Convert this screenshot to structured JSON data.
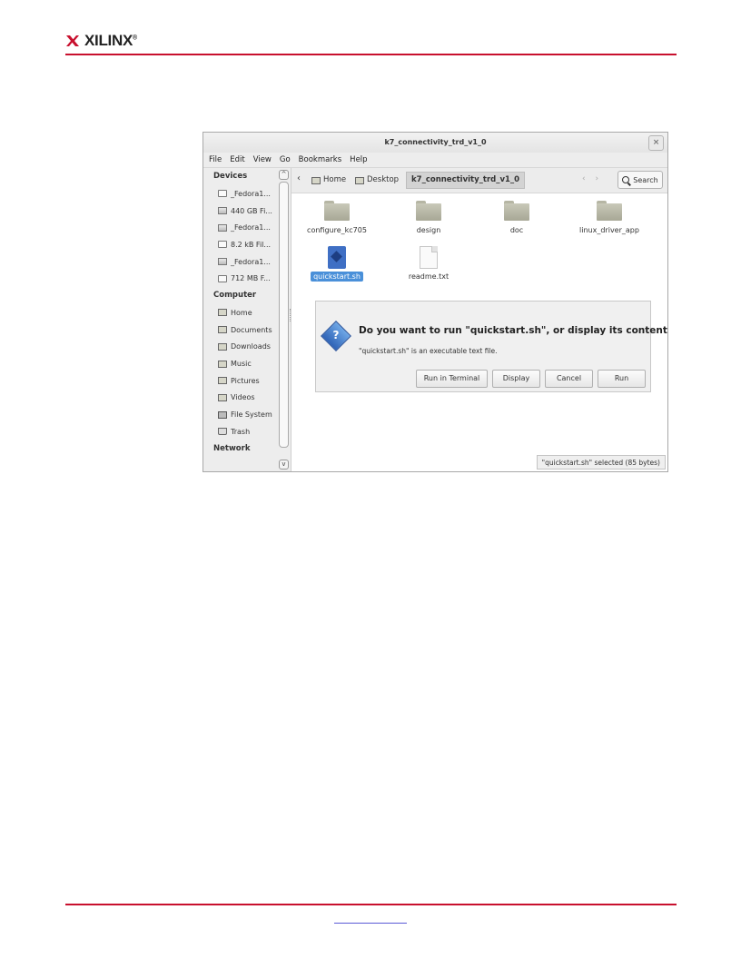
{
  "header": {
    "logo_text": "XILINX",
    "logo_mark": "®"
  },
  "window": {
    "title": "k7_connectivity_trd_v1_0",
    "menu": [
      "File",
      "Edit",
      "View",
      "Go",
      "Bookmarks",
      "Help"
    ],
    "close_label": "×"
  },
  "sidebar": {
    "devices_heading": "Devices",
    "devices": [
      "_Fedora1...",
      "440 GB Fi...",
      "_Fedora1...",
      "8.2 kB Fil...",
      "_Fedora1...",
      "712 MB F..."
    ],
    "computer_heading": "Computer",
    "places": [
      "Home",
      "Documents",
      "Downloads",
      "Music",
      "Pictures",
      "Videos",
      "File System",
      "Trash"
    ],
    "network_heading": "Network"
  },
  "toolbar": {
    "back": "‹",
    "crumbs": [
      "Home",
      "Desktop",
      "k7_connectivity_trd_v1_0"
    ],
    "nav_arrows": "‹ ›",
    "search_label": "Search"
  },
  "files": [
    {
      "name": "configure_kc705",
      "type": "folder"
    },
    {
      "name": "design",
      "type": "folder"
    },
    {
      "name": "doc",
      "type": "folder"
    },
    {
      "name": "linux_driver_app",
      "type": "folder"
    },
    {
      "name": "quickstart.sh",
      "type": "script",
      "selected": true
    },
    {
      "name": "readme.txt",
      "type": "text"
    }
  ],
  "dialog": {
    "title": "Do you want to run \"quickstart.sh\", or display its contents?",
    "subtitle": "\"quickstart.sh\" is an executable text file.",
    "buttons": [
      "Run in Terminal",
      "Display",
      "Cancel",
      "Run"
    ]
  },
  "status": "\"quickstart.sh\" selected (85 bytes)",
  "colors": {
    "accent_rule": "#c8102e",
    "selection": "#4a90d9"
  }
}
